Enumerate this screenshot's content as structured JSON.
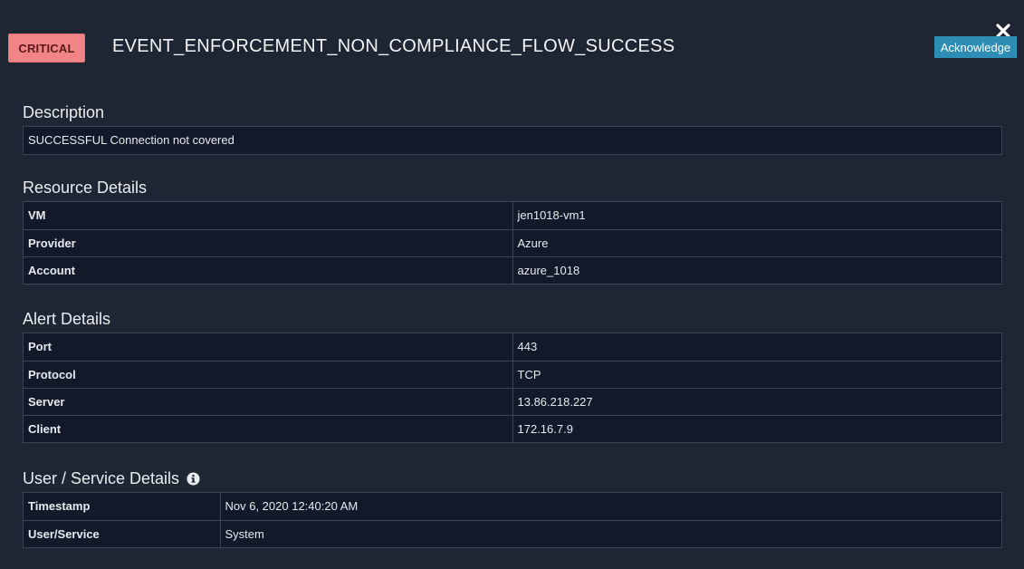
{
  "header": {
    "severity": "CRITICAL",
    "title": "EVENT_ENFORCEMENT_NON_COMPLIANCE_FLOW_SUCCESS",
    "acknowledge_label": "Acknowledge"
  },
  "description": {
    "title": "Description",
    "text": "SUCCESSFUL Connection not covered"
  },
  "resource_details": {
    "title": "Resource Details",
    "rows": [
      {
        "label": "VM",
        "value": "jen1018-vm1"
      },
      {
        "label": "Provider",
        "value": "Azure"
      },
      {
        "label": "Account",
        "value": "azure_1018"
      }
    ]
  },
  "alert_details": {
    "title": "Alert Details",
    "rows": [
      {
        "label": "Port",
        "value": "443"
      },
      {
        "label": "Protocol",
        "value": "TCP"
      },
      {
        "label": "Server",
        "value": "13.86.218.227"
      },
      {
        "label": "Client",
        "value": "172.16.7.9"
      }
    ]
  },
  "user_service_details": {
    "title": "User / Service Details",
    "rows": [
      {
        "label": "Timestamp",
        "value": "Nov 6, 2020 12:40:20 AM"
      },
      {
        "label": "User/Service",
        "value": "System"
      }
    ]
  },
  "colors": {
    "background": "#1e2633",
    "table_background": "#121a2a",
    "critical_badge": "#f08486",
    "acknowledge_button": "#2d8db5"
  },
  "icons": {
    "close": "close-icon",
    "info": "info-icon"
  }
}
